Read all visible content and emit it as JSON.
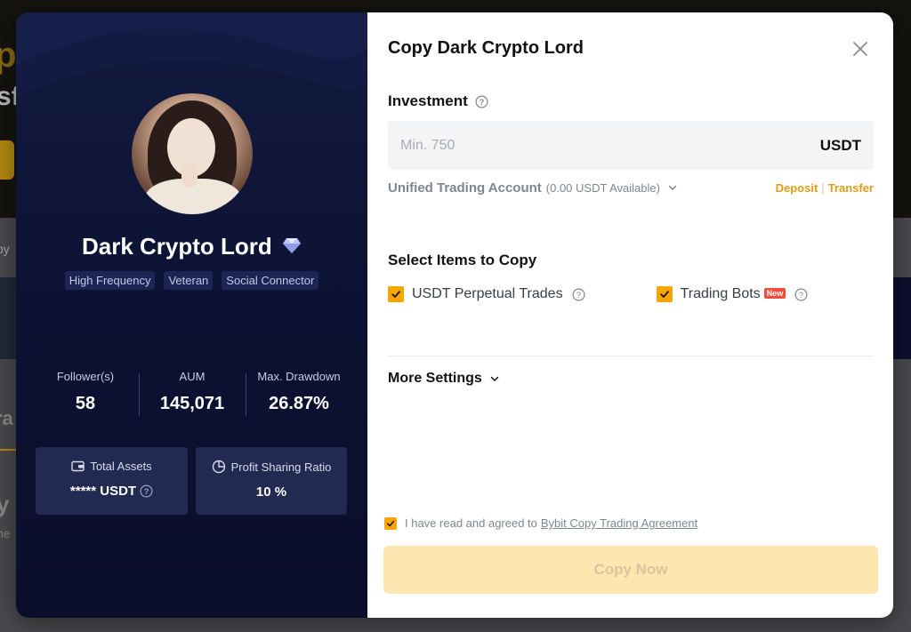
{
  "background": {
    "header_text_1": "py",
    "header_text_2": "sf",
    "band_text": "py",
    "mid_text_1": "ra",
    "mid_text_2": "y",
    "mid_text_3": "ne"
  },
  "trader": {
    "name": "Dark Crypto Lord",
    "verified_icon": "diamond-badge-icon",
    "tags": [
      "High Frequency",
      "Veteran",
      "Social Connector"
    ],
    "stats": [
      {
        "label": "Follower(s)",
        "value": "58"
      },
      {
        "label": "AUM",
        "value": "145,071"
      },
      {
        "label": "Max. Drawdown",
        "value": "26.87%"
      }
    ],
    "total_assets": {
      "label": "Total Assets",
      "value": "***** USDT",
      "icon": "wallet-icon"
    },
    "profit_sharing": {
      "label": "Profit Sharing Ratio",
      "value": "10 %",
      "icon": "pie-chart-icon"
    }
  },
  "modal": {
    "title": "Copy Dark Crypto Lord",
    "close_icon": "close-icon",
    "investment": {
      "label": "Investment",
      "placeholder": "Min. 750",
      "value": "",
      "unit": "USDT"
    },
    "account": {
      "name": "Unified Trading Account",
      "available": "(0.00 USDT Available)",
      "deposit_label": "Deposit",
      "separator": "|",
      "transfer_label": "Transfer"
    },
    "select_items": {
      "label": "Select Items to Copy",
      "items": [
        {
          "label": "USDT Perpetual Trades",
          "checked": true
        },
        {
          "label": "Trading Bots",
          "checked": true,
          "badge": "New"
        }
      ]
    },
    "more_settings_label": "More Settings",
    "agreement": {
      "text": "I have read and agreed to",
      "link": "Bybit Copy Trading Agreement",
      "checked": true
    },
    "submit_label": "Copy Now"
  },
  "colors": {
    "accent": "#f7a600",
    "link": "#e09c14",
    "left_panel_bg": "#0c1233",
    "new_badge": "#f24e39"
  }
}
